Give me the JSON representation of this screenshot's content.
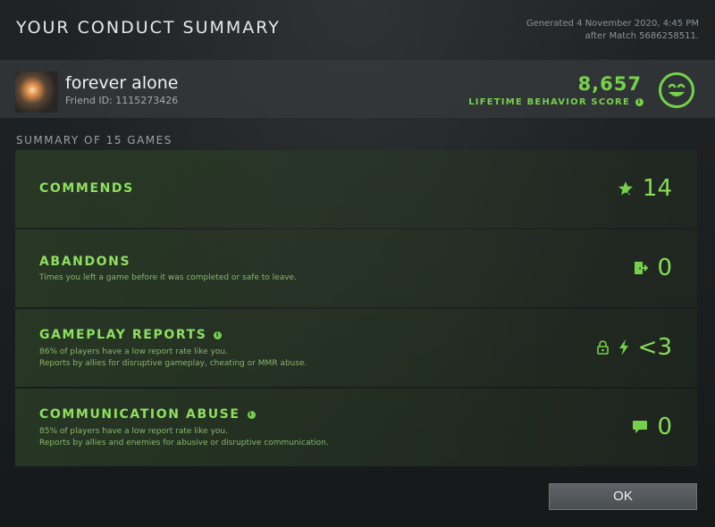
{
  "dialog": {
    "title": "YOUR CONDUCT SUMMARY",
    "generated_line1": "Generated 4 November 2020, 4:45 PM",
    "generated_line2": "after Match 5686258511."
  },
  "profile": {
    "name": "forever alone",
    "friend_id": "Friend ID: 1115273426",
    "score": "8,657",
    "score_label": "LIFETIME BEHAVIOR SCORE",
    "mood_icon": "smiley-face-icon"
  },
  "summary": {
    "heading": "SUMMARY OF 15 GAMES",
    "rows": [
      {
        "title": "COMMENDS",
        "line1": "",
        "line2": "",
        "icon": "star-commend-icon",
        "value": "14"
      },
      {
        "title": "ABANDONS",
        "line1": "Times you left a game before it was completed or safe to leave.",
        "line2": "",
        "icon": "exit-door-icon",
        "value": "0"
      },
      {
        "title": "GAMEPLAY REPORTS",
        "line1": "86% of players have a low report rate like you.",
        "line2": "Reports by allies for disruptive gameplay, cheating or MMR abuse.",
        "icon": "lock-lightning-icon",
        "value": "<3"
      },
      {
        "title": "COMMUNICATION ABUSE",
        "line1": "85% of players have a low report rate like you.",
        "line2": "Reports by allies and enemies for abusive or disruptive communication.",
        "icon": "chat-bubble-icon",
        "value": "0"
      }
    ]
  },
  "footer": {
    "ok_label": "OK"
  },
  "colors": {
    "accent_green": "#76d14a",
    "row_background": "#2c4026"
  }
}
